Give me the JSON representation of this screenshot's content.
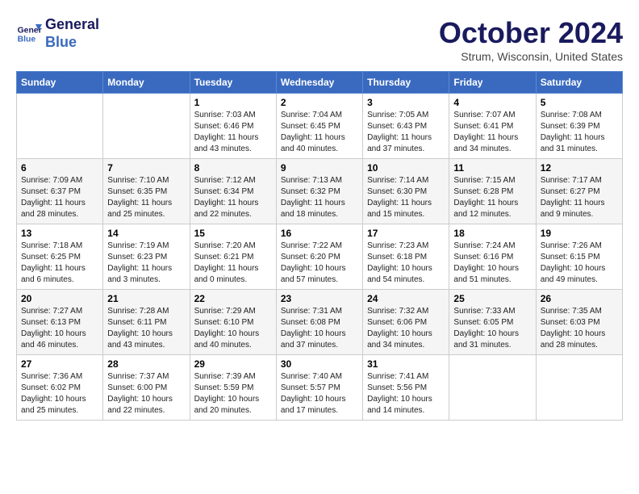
{
  "header": {
    "logo_line1": "General",
    "logo_line2": "Blue",
    "month_title": "October 2024",
    "location": "Strum, Wisconsin, United States"
  },
  "days_of_week": [
    "Sunday",
    "Monday",
    "Tuesday",
    "Wednesday",
    "Thursday",
    "Friday",
    "Saturday"
  ],
  "weeks": [
    [
      {
        "day": "",
        "info": ""
      },
      {
        "day": "",
        "info": ""
      },
      {
        "day": "1",
        "info": "Sunrise: 7:03 AM\nSunset: 6:46 PM\nDaylight: 11 hours and 43 minutes."
      },
      {
        "day": "2",
        "info": "Sunrise: 7:04 AM\nSunset: 6:45 PM\nDaylight: 11 hours and 40 minutes."
      },
      {
        "day": "3",
        "info": "Sunrise: 7:05 AM\nSunset: 6:43 PM\nDaylight: 11 hours and 37 minutes."
      },
      {
        "day": "4",
        "info": "Sunrise: 7:07 AM\nSunset: 6:41 PM\nDaylight: 11 hours and 34 minutes."
      },
      {
        "day": "5",
        "info": "Sunrise: 7:08 AM\nSunset: 6:39 PM\nDaylight: 11 hours and 31 minutes."
      }
    ],
    [
      {
        "day": "6",
        "info": "Sunrise: 7:09 AM\nSunset: 6:37 PM\nDaylight: 11 hours and 28 minutes."
      },
      {
        "day": "7",
        "info": "Sunrise: 7:10 AM\nSunset: 6:35 PM\nDaylight: 11 hours and 25 minutes."
      },
      {
        "day": "8",
        "info": "Sunrise: 7:12 AM\nSunset: 6:34 PM\nDaylight: 11 hours and 22 minutes."
      },
      {
        "day": "9",
        "info": "Sunrise: 7:13 AM\nSunset: 6:32 PM\nDaylight: 11 hours and 18 minutes."
      },
      {
        "day": "10",
        "info": "Sunrise: 7:14 AM\nSunset: 6:30 PM\nDaylight: 11 hours and 15 minutes."
      },
      {
        "day": "11",
        "info": "Sunrise: 7:15 AM\nSunset: 6:28 PM\nDaylight: 11 hours and 12 minutes."
      },
      {
        "day": "12",
        "info": "Sunrise: 7:17 AM\nSunset: 6:27 PM\nDaylight: 11 hours and 9 minutes."
      }
    ],
    [
      {
        "day": "13",
        "info": "Sunrise: 7:18 AM\nSunset: 6:25 PM\nDaylight: 11 hours and 6 minutes."
      },
      {
        "day": "14",
        "info": "Sunrise: 7:19 AM\nSunset: 6:23 PM\nDaylight: 11 hours and 3 minutes."
      },
      {
        "day": "15",
        "info": "Sunrise: 7:20 AM\nSunset: 6:21 PM\nDaylight: 11 hours and 0 minutes."
      },
      {
        "day": "16",
        "info": "Sunrise: 7:22 AM\nSunset: 6:20 PM\nDaylight: 10 hours and 57 minutes."
      },
      {
        "day": "17",
        "info": "Sunrise: 7:23 AM\nSunset: 6:18 PM\nDaylight: 10 hours and 54 minutes."
      },
      {
        "day": "18",
        "info": "Sunrise: 7:24 AM\nSunset: 6:16 PM\nDaylight: 10 hours and 51 minutes."
      },
      {
        "day": "19",
        "info": "Sunrise: 7:26 AM\nSunset: 6:15 PM\nDaylight: 10 hours and 49 minutes."
      }
    ],
    [
      {
        "day": "20",
        "info": "Sunrise: 7:27 AM\nSunset: 6:13 PM\nDaylight: 10 hours and 46 minutes."
      },
      {
        "day": "21",
        "info": "Sunrise: 7:28 AM\nSunset: 6:11 PM\nDaylight: 10 hours and 43 minutes."
      },
      {
        "day": "22",
        "info": "Sunrise: 7:29 AM\nSunset: 6:10 PM\nDaylight: 10 hours and 40 minutes."
      },
      {
        "day": "23",
        "info": "Sunrise: 7:31 AM\nSunset: 6:08 PM\nDaylight: 10 hours and 37 minutes."
      },
      {
        "day": "24",
        "info": "Sunrise: 7:32 AM\nSunset: 6:06 PM\nDaylight: 10 hours and 34 minutes."
      },
      {
        "day": "25",
        "info": "Sunrise: 7:33 AM\nSunset: 6:05 PM\nDaylight: 10 hours and 31 minutes."
      },
      {
        "day": "26",
        "info": "Sunrise: 7:35 AM\nSunset: 6:03 PM\nDaylight: 10 hours and 28 minutes."
      }
    ],
    [
      {
        "day": "27",
        "info": "Sunrise: 7:36 AM\nSunset: 6:02 PM\nDaylight: 10 hours and 25 minutes."
      },
      {
        "day": "28",
        "info": "Sunrise: 7:37 AM\nSunset: 6:00 PM\nDaylight: 10 hours and 22 minutes."
      },
      {
        "day": "29",
        "info": "Sunrise: 7:39 AM\nSunset: 5:59 PM\nDaylight: 10 hours and 20 minutes."
      },
      {
        "day": "30",
        "info": "Sunrise: 7:40 AM\nSunset: 5:57 PM\nDaylight: 10 hours and 17 minutes."
      },
      {
        "day": "31",
        "info": "Sunrise: 7:41 AM\nSunset: 5:56 PM\nDaylight: 10 hours and 14 minutes."
      },
      {
        "day": "",
        "info": ""
      },
      {
        "day": "",
        "info": ""
      }
    ]
  ]
}
